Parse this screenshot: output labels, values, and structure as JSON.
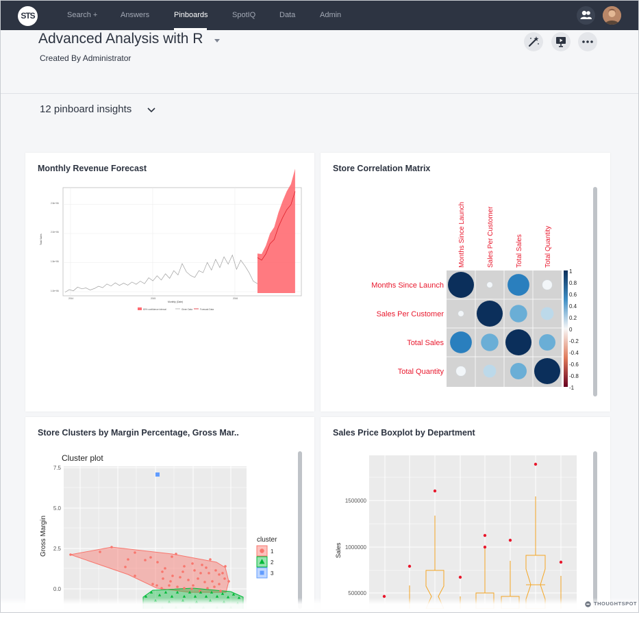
{
  "nav": {
    "logo_text": "STS",
    "items": [
      {
        "label": "Search +",
        "active": false
      },
      {
        "label": "Answers",
        "active": false
      },
      {
        "label": "Pinboards",
        "active": true
      },
      {
        "label": "SpotIQ",
        "active": false
      },
      {
        "label": "Data",
        "active": false
      },
      {
        "label": "Admin",
        "active": false
      }
    ],
    "icons": [
      "people-icon",
      "user-avatar"
    ]
  },
  "header": {
    "title": "Advanced Analysis with R",
    "subtitle": "Created By Administrator",
    "actions": [
      "magic-wand-icon",
      "present-icon",
      "more-icon"
    ]
  },
  "insights": {
    "label": "12 pinboard insights"
  },
  "cards": [
    {
      "title": "Monthly Revenue Forecast",
      "chart_data": {
        "type": "area",
        "series": [
          {
            "name": "Given Data",
            "values": [
              0.3,
              1.2,
              0.8,
              2.1,
              1.5,
              1.8,
              1.1,
              1.6,
              2.4,
              1.9,
              3.2,
              2.5,
              3.6,
              2.7,
              3.5,
              2.8,
              3.9,
              3.1,
              4.2,
              3.3,
              5.4,
              4.3,
              6.1,
              4.6,
              6.8,
              5.2,
              7.9,
              6.4,
              10.4,
              7.5,
              6.2,
              5.5,
              7.9,
              7.2,
              10.8,
              8.1,
              11.9,
              9.0,
              12.8,
              10.2,
              13.4,
              8.4,
              11.6,
              9.6,
              7.2,
              4.2,
              3.3
            ]
          },
          {
            "name": "Forecast Data",
            "values": [
              12.5,
              11.6,
              13.8,
              17.4,
              18.9,
              23.3,
              26.6,
              29.4,
              31.2,
              35.9
            ]
          },
          {
            "name": "80% confidence interval",
            "values": []
          }
        ],
        "x_tick_labels": [
          "2014",
          "2015",
          "2016"
        ],
        "y_tick_labels": [
          "1.0e+06",
          "1.5e+06",
          "2.0e+06",
          "2.5e+06"
        ],
        "xlabel": "Monthly (Date)",
        "ylabel": "Total Sales",
        "legend_position": "bottom"
      }
    },
    {
      "title": "Store Correlation Matrix",
      "chart_data": {
        "type": "heatmap",
        "variables": [
          "Months Since Launch",
          "Sales Per Customer",
          "Total Sales",
          "Total Quantity"
        ],
        "matrix": [
          [
            1.0,
            0.05,
            0.7,
            0.15
          ],
          [
            0.05,
            1.0,
            0.45,
            0.25
          ],
          [
            0.7,
            0.45,
            1.0,
            0.4
          ],
          [
            0.15,
            0.25,
            0.4,
            1.0
          ]
        ],
        "colorbar_ticks": [
          "1",
          "0.8",
          "0.6",
          "0.4",
          "0.2",
          "0",
          "-0.2",
          "-0.4",
          "-0.6",
          "-0.8",
          "-1"
        ],
        "label_color": "#e8172c",
        "pos_color": "#0b2f5b",
        "neg_color": "#67001f"
      }
    },
    {
      "title": "Store Clusters by Margin Percentage, Gross Mar..",
      "chart_data": {
        "type": "scatter",
        "title": "Cluster plot",
        "ylabel": "Gross Margin",
        "y_tick_labels": [
          "7.5",
          "5.0",
          "2.5",
          "0.0"
        ],
        "legend_title": "cluster",
        "clusters": [
          {
            "name": "1",
            "color": "#f8766d",
            "shape": "circle"
          },
          {
            "name": "2",
            "color": "#00ba38",
            "shape": "triangle"
          },
          {
            "name": "3",
            "color": "#619cff",
            "shape": "square"
          }
        ]
      }
    },
    {
      "title": "Sales Price Boxplot by Department",
      "chart_data": {
        "type": "boxplot",
        "ylabel": "Sales",
        "y_tick_labels": [
          "1500000",
          "1000000",
          "500000"
        ],
        "outlier_color": "#e8172c",
        "box_color": "#f5a623"
      }
    }
  ],
  "footer": {
    "brand": "THOUGHTSPOT"
  }
}
